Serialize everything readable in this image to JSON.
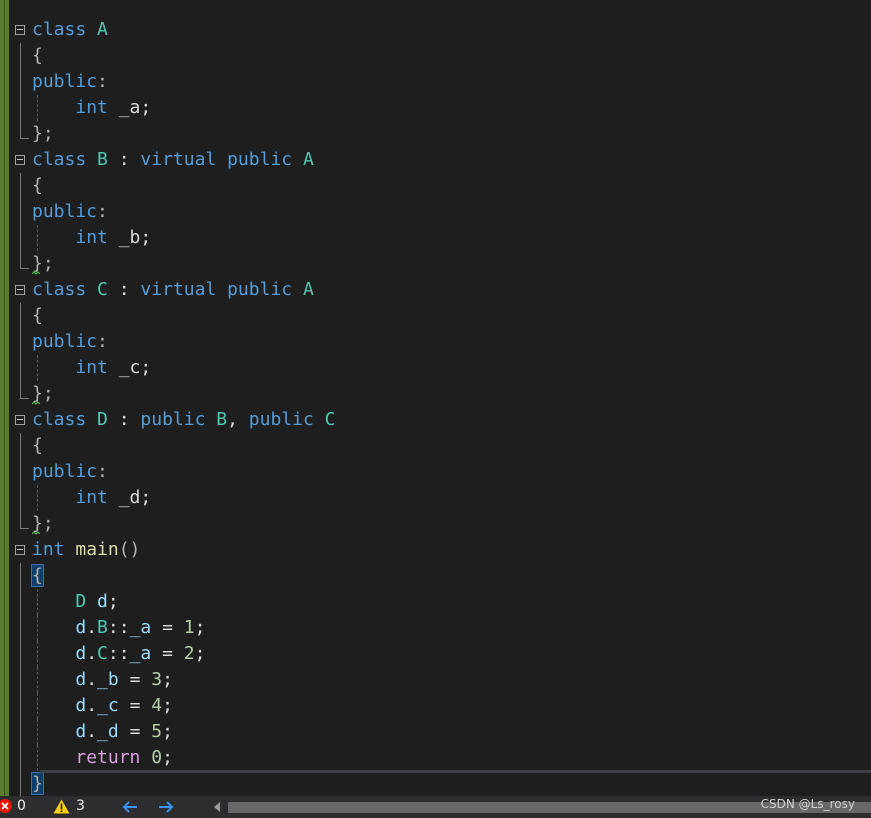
{
  "editor": {
    "lines": [
      {
        "fold": true,
        "tokens": [
          {
            "t": "class",
            "c": "kw"
          },
          {
            "t": " "
          },
          {
            "t": "A",
            "c": "cls"
          }
        ]
      },
      {
        "guide": "v",
        "tokens": [
          {
            "t": "{",
            "c": "pun"
          }
        ]
      },
      {
        "guide": "v",
        "tokens": [
          {
            "t": "public",
            "c": "kw"
          },
          {
            "t": ":",
            "c": "pun"
          }
        ]
      },
      {
        "guide": "v",
        "dash": true,
        "tokens": [
          {
            "t": "    "
          },
          {
            "t": "int",
            "c": "kw"
          },
          {
            "t": " _a;",
            "c": ""
          }
        ]
      },
      {
        "guide": "end",
        "tokens": [
          {
            "t": "};",
            "c": "pun"
          }
        ]
      },
      {
        "fold": true,
        "tokens": [
          {
            "t": "class",
            "c": "kw"
          },
          {
            "t": " "
          },
          {
            "t": "B",
            "c": "cls"
          },
          {
            "t": " : "
          },
          {
            "t": "virtual",
            "c": "kw"
          },
          {
            "t": " "
          },
          {
            "t": "public",
            "c": "kw"
          },
          {
            "t": " "
          },
          {
            "t": "A",
            "c": "cls"
          }
        ]
      },
      {
        "guide": "v",
        "tokens": [
          {
            "t": "{",
            "c": "pun"
          }
        ]
      },
      {
        "guide": "v",
        "tokens": [
          {
            "t": "public",
            "c": "kw"
          },
          {
            "t": ":",
            "c": "pun"
          }
        ]
      },
      {
        "guide": "v",
        "dash": true,
        "tokens": [
          {
            "t": "    "
          },
          {
            "t": "int",
            "c": "kw"
          },
          {
            "t": " _b;",
            "c": ""
          }
        ]
      },
      {
        "guide": "end",
        "squiggle": true,
        "tokens": [
          {
            "t": "};",
            "c": "pun"
          }
        ]
      },
      {
        "fold": true,
        "tokens": [
          {
            "t": "class",
            "c": "kw"
          },
          {
            "t": " "
          },
          {
            "t": "C",
            "c": "cls"
          },
          {
            "t": " : "
          },
          {
            "t": "virtual",
            "c": "kw"
          },
          {
            "t": " "
          },
          {
            "t": "public",
            "c": "kw"
          },
          {
            "t": " "
          },
          {
            "t": "A",
            "c": "cls"
          }
        ]
      },
      {
        "guide": "v",
        "tokens": [
          {
            "t": "{",
            "c": "pun"
          }
        ]
      },
      {
        "guide": "v",
        "tokens": [
          {
            "t": "public",
            "c": "kw"
          },
          {
            "t": ":",
            "c": "pun"
          }
        ]
      },
      {
        "guide": "v",
        "dash": true,
        "tokens": [
          {
            "t": "    "
          },
          {
            "t": "int",
            "c": "kw"
          },
          {
            "t": " _c;",
            "c": ""
          }
        ]
      },
      {
        "guide": "end",
        "squiggle": true,
        "tokens": [
          {
            "t": "};",
            "c": "pun"
          }
        ]
      },
      {
        "fold": true,
        "tokens": [
          {
            "t": "class",
            "c": "kw"
          },
          {
            "t": " "
          },
          {
            "t": "D",
            "c": "cls"
          },
          {
            "t": " : "
          },
          {
            "t": "public",
            "c": "kw"
          },
          {
            "t": " "
          },
          {
            "t": "B",
            "c": "cls"
          },
          {
            "t": ", "
          },
          {
            "t": "public",
            "c": "kw"
          },
          {
            "t": " "
          },
          {
            "t": "C",
            "c": "cls"
          }
        ]
      },
      {
        "guide": "v",
        "tokens": [
          {
            "t": "{",
            "c": "pun"
          }
        ]
      },
      {
        "guide": "v",
        "tokens": [
          {
            "t": "public",
            "c": "kw"
          },
          {
            "t": ":",
            "c": "pun"
          }
        ]
      },
      {
        "guide": "v",
        "dash": true,
        "tokens": [
          {
            "t": "    "
          },
          {
            "t": "int",
            "c": "kw"
          },
          {
            "t": " _d;",
            "c": ""
          }
        ]
      },
      {
        "guide": "end",
        "squiggle": true,
        "tokens": [
          {
            "t": "};",
            "c": "pun"
          }
        ]
      },
      {
        "fold": true,
        "tokens": [
          {
            "t": "int",
            "c": "kw"
          },
          {
            "t": " "
          },
          {
            "t": "main",
            "c": "fn"
          },
          {
            "t": "()",
            "c": "pun"
          }
        ]
      },
      {
        "guide": "v",
        "tokens": [
          {
            "t": "{",
            "c": "pun brace-hl"
          }
        ]
      },
      {
        "guide": "v",
        "dash": true,
        "tokens": [
          {
            "t": "    "
          },
          {
            "t": "D",
            "c": "cls"
          },
          {
            "t": " "
          },
          {
            "t": "d",
            "c": "var"
          },
          {
            "t": ";"
          }
        ]
      },
      {
        "guide": "v",
        "dash": true,
        "tokens": [
          {
            "t": "    "
          },
          {
            "t": "d",
            "c": "var"
          },
          {
            "t": "."
          },
          {
            "t": "B",
            "c": "cls"
          },
          {
            "t": "::"
          },
          {
            "t": "_a",
            "c": "var"
          },
          {
            "t": " = "
          },
          {
            "t": "1",
            "c": "num"
          },
          {
            "t": ";"
          }
        ]
      },
      {
        "guide": "v",
        "dash": true,
        "tokens": [
          {
            "t": "    "
          },
          {
            "t": "d",
            "c": "var"
          },
          {
            "t": "."
          },
          {
            "t": "C",
            "c": "cls"
          },
          {
            "t": "::"
          },
          {
            "t": "_a",
            "c": "var"
          },
          {
            "t": " = "
          },
          {
            "t": "2",
            "c": "num"
          },
          {
            "t": ";"
          }
        ]
      },
      {
        "guide": "v",
        "dash": true,
        "tokens": [
          {
            "t": "    "
          },
          {
            "t": "d",
            "c": "var"
          },
          {
            "t": "."
          },
          {
            "t": "_b",
            "c": "var"
          },
          {
            "t": " = "
          },
          {
            "t": "3",
            "c": "num"
          },
          {
            "t": ";"
          }
        ]
      },
      {
        "guide": "v",
        "dash": true,
        "tokens": [
          {
            "t": "    "
          },
          {
            "t": "d",
            "c": "var"
          },
          {
            "t": "."
          },
          {
            "t": "_c",
            "c": "var"
          },
          {
            "t": " = "
          },
          {
            "t": "4",
            "c": "num"
          },
          {
            "t": ";"
          }
        ]
      },
      {
        "guide": "v",
        "dash": true,
        "tokens": [
          {
            "t": "    "
          },
          {
            "t": "d",
            "c": "var"
          },
          {
            "t": "."
          },
          {
            "t": "_d",
            "c": "var"
          },
          {
            "t": " = "
          },
          {
            "t": "5",
            "c": "num"
          },
          {
            "t": ";"
          }
        ]
      },
      {
        "guide": "v",
        "dash": true,
        "tokens": [
          {
            "t": "    "
          },
          {
            "t": "return",
            "c": "ctl"
          },
          {
            "t": " "
          },
          {
            "t": "0",
            "c": "num"
          },
          {
            "t": ";"
          }
        ]
      },
      {
        "guide": "v",
        "tokens": [
          {
            "t": "}",
            "c": "pun brace-hl"
          }
        ]
      }
    ]
  },
  "statusbar": {
    "error_count": "0",
    "warning_count": "3",
    "watermark": "CSDN @Ls_rosy",
    "colors": {
      "error": "#e51400",
      "warning": "#ffcc00",
      "nav": "#3794ff"
    }
  }
}
